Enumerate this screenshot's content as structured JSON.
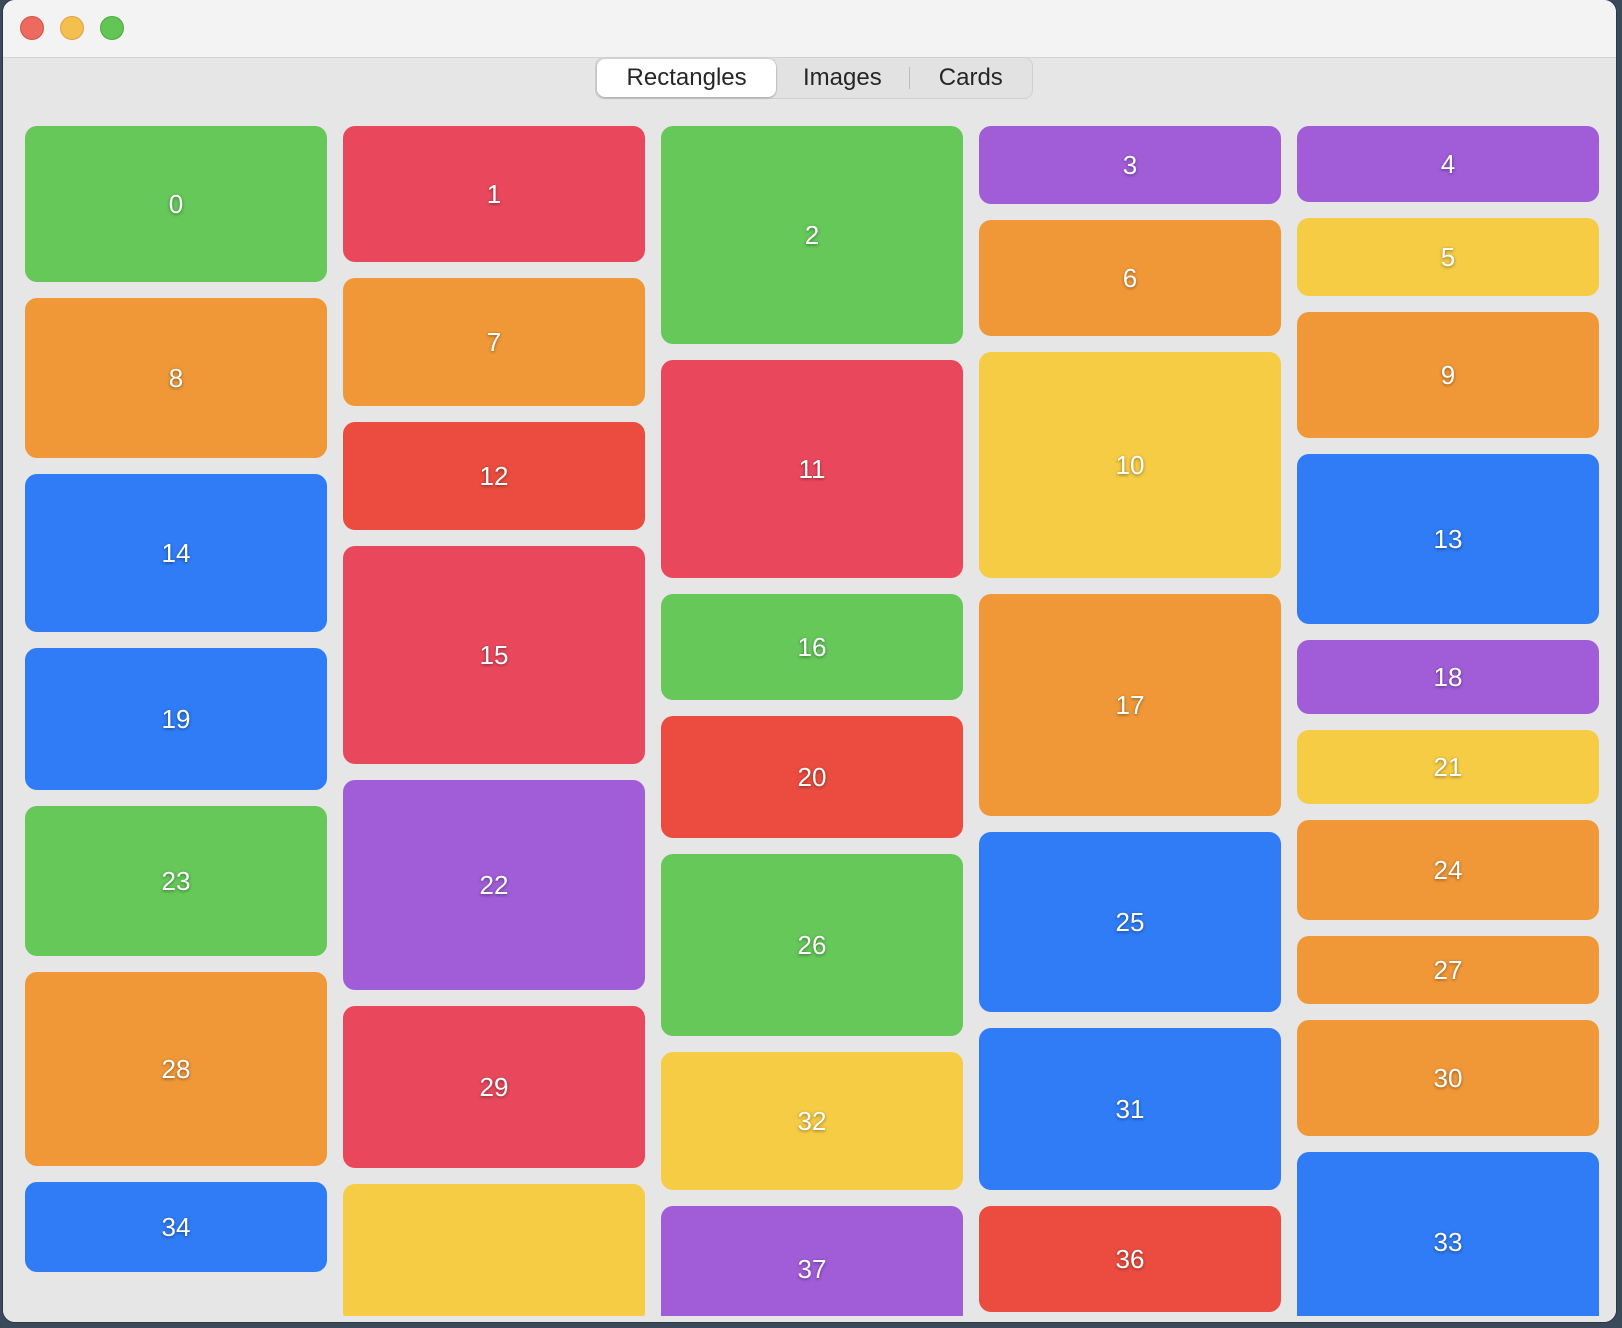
{
  "window": {
    "controls": [
      "close",
      "minimize",
      "zoom"
    ]
  },
  "tabs": [
    {
      "label": "Rectangles",
      "selected": true
    },
    {
      "label": "Images",
      "selected": false
    },
    {
      "label": "Cards",
      "selected": false
    }
  ],
  "colors": {
    "green": "#65c859",
    "red": "#e9485c",
    "orange": "#f09838",
    "purple": "#a15cd8",
    "yellow": "#f6cc45",
    "blue": "#2f7cf6",
    "red2": "#eb4c3f"
  },
  "tiles": [
    {
      "label": "0",
      "color": "green"
    },
    {
      "label": "1",
      "color": "red"
    },
    {
      "label": "2",
      "color": "green"
    },
    {
      "label": "3",
      "color": "purple"
    },
    {
      "label": "4",
      "color": "purple"
    },
    {
      "label": "5",
      "color": "yellow"
    },
    {
      "label": "6",
      "color": "orange"
    },
    {
      "label": "7",
      "color": "orange"
    },
    {
      "label": "8",
      "color": "orange"
    },
    {
      "label": "9",
      "color": "orange"
    },
    {
      "label": "10",
      "color": "yellow"
    },
    {
      "label": "11",
      "color": "red"
    },
    {
      "label": "12",
      "color": "red2"
    },
    {
      "label": "13",
      "color": "blue"
    },
    {
      "label": "14",
      "color": "blue"
    },
    {
      "label": "15",
      "color": "red"
    },
    {
      "label": "16",
      "color": "green"
    },
    {
      "label": "17",
      "color": "orange"
    },
    {
      "label": "18",
      "color": "purple"
    },
    {
      "label": "19",
      "color": "blue"
    },
    {
      "label": "20",
      "color": "red2"
    },
    {
      "label": "21",
      "color": "yellow"
    },
    {
      "label": "22",
      "color": "purple"
    },
    {
      "label": "23",
      "color": "green"
    },
    {
      "label": "24",
      "color": "orange"
    },
    {
      "label": "25",
      "color": "blue"
    },
    {
      "label": "26",
      "color": "green"
    },
    {
      "label": "27",
      "color": "orange"
    },
    {
      "label": "28",
      "color": "orange"
    },
    {
      "label": "29",
      "color": "red"
    },
    {
      "label": "30",
      "color": "orange"
    },
    {
      "label": "31",
      "color": "blue"
    },
    {
      "label": "32",
      "color": "yellow"
    },
    {
      "label": "33",
      "color": "blue"
    },
    {
      "label": "34",
      "color": "blue"
    },
    {
      "label": "",
      "color": "yellow"
    },
    {
      "label": "36",
      "color": "red2"
    },
    {
      "label": "37",
      "color": "purple"
    }
  ]
}
